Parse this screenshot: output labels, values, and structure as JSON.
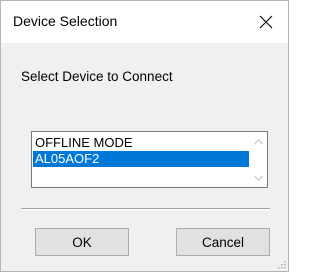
{
  "window": {
    "title": "Device Selection",
    "close_icon": "close-icon"
  },
  "main": {
    "prompt": "Select Device to Connect",
    "device_list": {
      "items": [
        {
          "label": "OFFLINE MODE",
          "selected": false
        },
        {
          "label": "AL05AOF2",
          "selected": true
        }
      ],
      "scroll_up_icon": "chevron-up-icon",
      "scroll_down_icon": "chevron-down-icon"
    }
  },
  "footer": {
    "ok_label": "OK",
    "cancel_label": "Cancel"
  },
  "colors": {
    "selection": "#0078d7",
    "selection_text": "#ffffff",
    "dialog_bg": "#f0f0f0",
    "button_bg": "#e1e1e1"
  }
}
